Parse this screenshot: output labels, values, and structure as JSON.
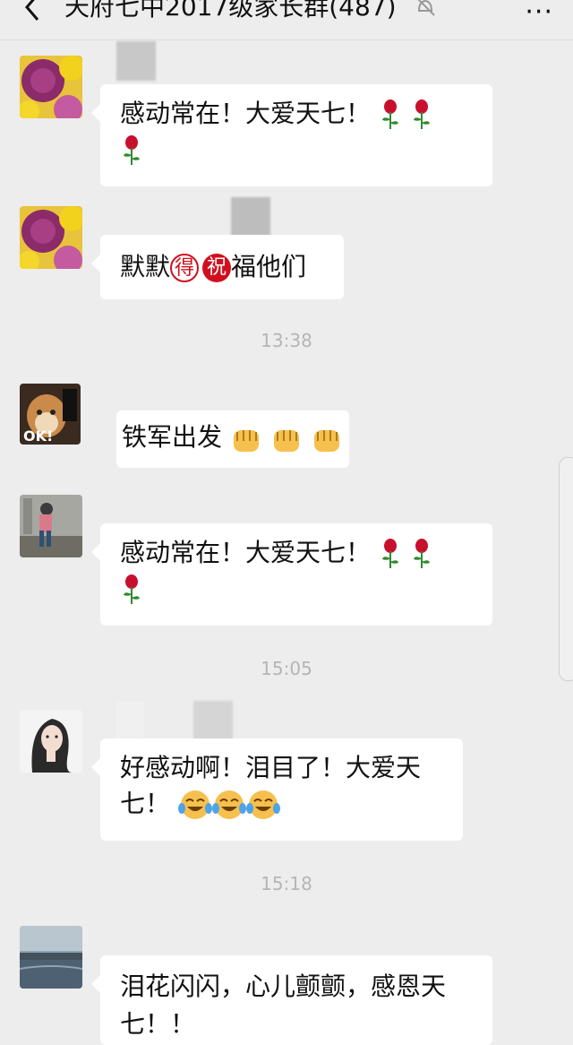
{
  "header": {
    "title": "天府七中2017级家长群(487)",
    "back_icon": "chevron-left-icon",
    "mute_icon": "bell-mute-icon",
    "more_label": "···"
  },
  "messages": [
    {
      "text_line1": "感动常在！大爱天七！",
      "emoji": "rose-icon"
    },
    {
      "text_before": "默默",
      "char1": "得",
      "char2": "祝",
      "text_after": "福他们"
    },
    {
      "text": "铁军出发",
      "emoji": "fist-icon"
    },
    {
      "text_line1": "感动常在！大爱天七！",
      "emoji": "rose-icon"
    },
    {
      "text_line1": "好感动啊！泪目了！大爱天",
      "text_line2": "七！",
      "emoji": "laugh-cry-icon"
    },
    {
      "text_line1": "泪花闪闪，心儿颤颤，感恩天",
      "text_line2": "七！！"
    }
  ],
  "timestamps": [
    "13:38",
    "15:05",
    "15:18"
  ]
}
